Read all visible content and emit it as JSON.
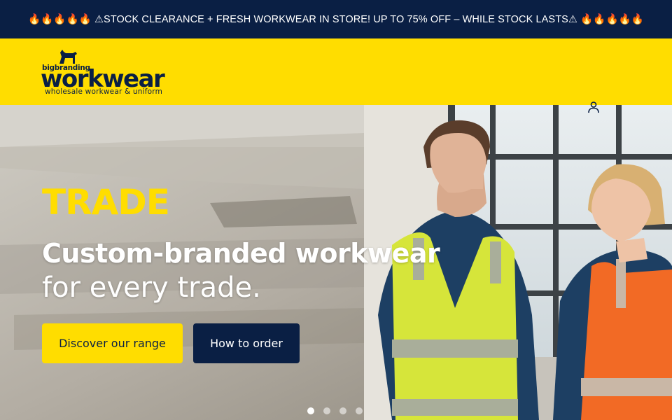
{
  "announcement": {
    "text": "🔥🔥🔥🔥🔥 ⚠STOCK CLEARANCE + FRESH WORKWEAR IN STORE! UP TO 75% OFF – WHILE STOCK LASTS⚠ 🔥🔥🔥🔥🔥"
  },
  "header": {
    "logo": {
      "small_text": "bigbranding",
      "big_text": "workwear",
      "tagline": "wholesale workwear & uniform"
    },
    "account_icon": "user-icon"
  },
  "hero": {
    "eyebrow": "TRADE",
    "title": "Custom-branded workwear",
    "subtitle": "for every trade.",
    "primary_button": "Discover our range",
    "secondary_button": "How to order",
    "slides_count": 4,
    "active_slide": 1
  },
  "colors": {
    "navy": "#0a1f44",
    "yellow": "#ffdd00",
    "white": "#ffffff"
  }
}
